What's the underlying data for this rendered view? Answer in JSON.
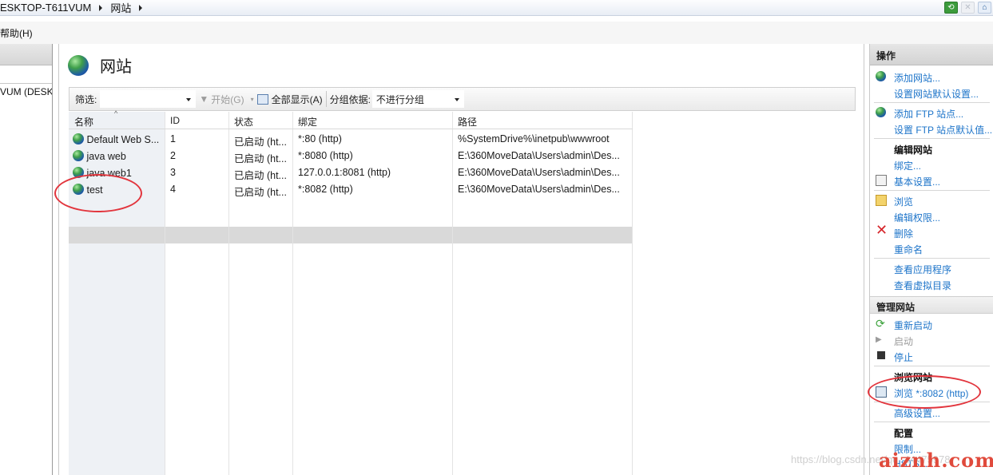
{
  "breadcrumb": {
    "host": "ESKTOP-T611VUM",
    "page": "网站"
  },
  "menu": {
    "help": "帮助(H)"
  },
  "connections": {
    "node": "VUM (DESK"
  },
  "page": {
    "title": "网站"
  },
  "filter": {
    "label": "筛选:",
    "value": "",
    "go_label": "开始(G)",
    "show_all_label": "全部显示(A)",
    "group_label": "分组依据:",
    "group_value": "不进行分组"
  },
  "table": {
    "columns": [
      "名称",
      "ID",
      "状态",
      "绑定",
      "路径"
    ],
    "rows": [
      {
        "name": "Default Web S...",
        "id": "1",
        "status": "已启动 (ht...",
        "binding": "*:80 (http)",
        "path": "%SystemDrive%\\inetpub\\wwwroot"
      },
      {
        "name": "java web",
        "id": "2",
        "status": "已启动 (ht...",
        "binding": "*:8080 (http)",
        "path": "E:\\360MoveData\\Users\\admin\\Des..."
      },
      {
        "name": "java web1",
        "id": "3",
        "status": "已启动 (ht...",
        "binding": "127.0.0.1:8081 (http)",
        "path": "E:\\360MoveData\\Users\\admin\\Des..."
      },
      {
        "name": "test",
        "id": "4",
        "status": "已启动 (ht...",
        "binding": "*:8082 (http)",
        "path": "E:\\360MoveData\\Users\\admin\\Des..."
      }
    ],
    "selected_index": 3
  },
  "actions": {
    "title": "操作",
    "add_site": "添加网站...",
    "site_defaults": "设置网站默认设置...",
    "add_ftp": "添加 FTP 站点...",
    "ftp_defaults": "设置 FTP 站点默认值...",
    "edit_site_heading": "编辑网站",
    "bindings": "绑定...",
    "basic_settings": "基本设置...",
    "explore": "浏览",
    "edit_permissions": "编辑权限...",
    "delete": "删除",
    "rename": "重命名",
    "view_apps": "查看应用程序",
    "view_vdirs": "查看虚拟目录",
    "manage_site_heading": "管理网站",
    "restart": "重新启动",
    "start": "启动",
    "stop": "停止",
    "browse_site_heading": "浏览网站",
    "browse_8082": "浏览 *:8082 (http)",
    "advanced_settings": "高级设置...",
    "config_heading": "配置",
    "limits": "限制...",
    "hsts": "HSTS..."
  },
  "watermark": "https://blog.csdn.net/qq_44475978",
  "brand": "aiznh.com",
  "colors": {
    "link": "#1d74c9",
    "annotation": "#e2353d",
    "selected_row": "#d9d9d9"
  }
}
